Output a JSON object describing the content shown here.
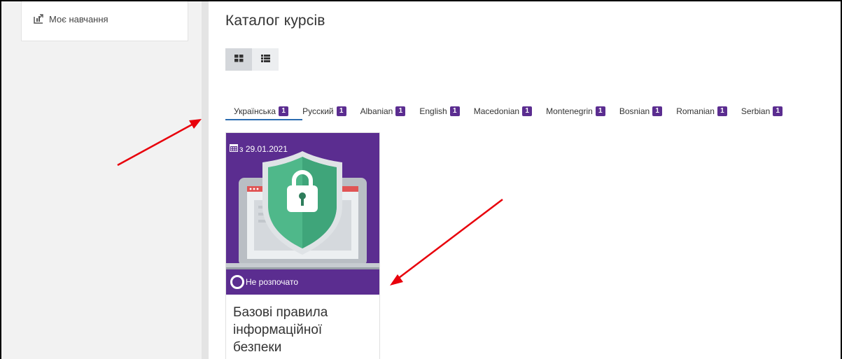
{
  "sidebar": {
    "items": [
      {
        "label": "Моє навчання",
        "icon": "learning-icon"
      }
    ]
  },
  "main": {
    "title": "Каталог курсів",
    "view_toggle": {
      "grid_icon": "grid-view-icon",
      "list_icon": "list-view-icon",
      "active": "grid"
    },
    "tabs": [
      {
        "label": "Українська",
        "count": "1"
      },
      {
        "label": "Русский",
        "count": "1"
      },
      {
        "label": "Albanian",
        "count": "1"
      },
      {
        "label": "English",
        "count": "1"
      },
      {
        "label": "Macedonian",
        "count": "1"
      },
      {
        "label": "Montenegrin",
        "count": "1"
      },
      {
        "label": "Bosnian",
        "count": "1"
      },
      {
        "label": "Romanian",
        "count": "1"
      },
      {
        "label": "Serbian",
        "count": "1"
      }
    ],
    "active_tab": "Українська",
    "course_card": {
      "date": "з 29.01.2021",
      "status": "Не розпочато",
      "title": "Базові правила інформаційної безпеки"
    }
  },
  "colors": {
    "accent_purple": "#5b2d90",
    "tab_underline": "#2b6cb0",
    "annotation_arrow": "#e8000b"
  }
}
